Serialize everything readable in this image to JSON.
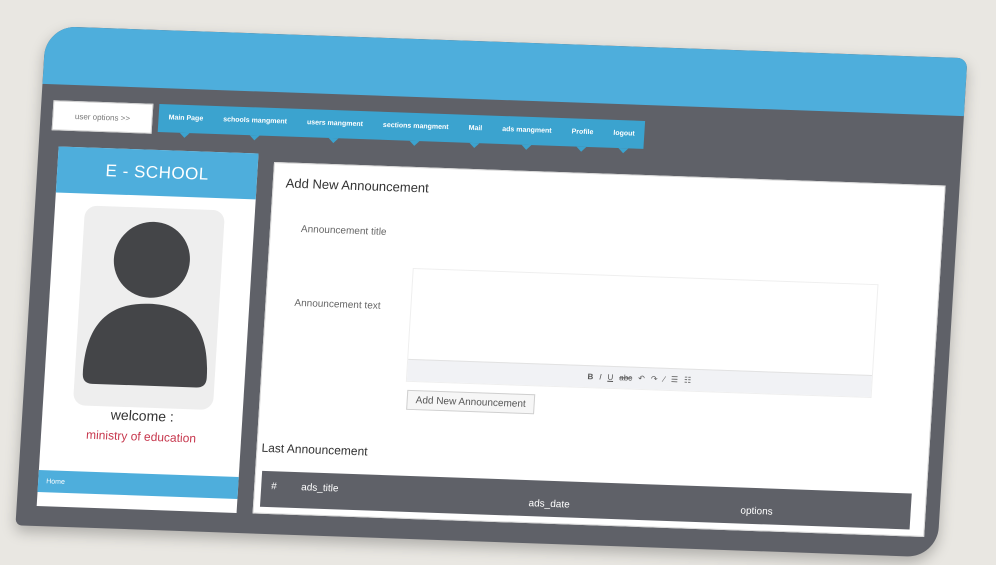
{
  "top": {
    "user_options_label": "user options >>"
  },
  "nav": {
    "items": [
      {
        "label": "Main Page"
      },
      {
        "label": "schools mangment"
      },
      {
        "label": "users mangment"
      },
      {
        "label": "sections mangment"
      },
      {
        "label": "Mail"
      },
      {
        "label": "ads mangment"
      },
      {
        "label": "Profile"
      },
      {
        "label": "logout"
      }
    ]
  },
  "sidebar": {
    "brand": "E - SCHOOL",
    "avatar_icon": "user-silhouette-icon",
    "welcome": "welcome :",
    "user_name": "ministry of education",
    "home_link": "Home"
  },
  "form": {
    "title": "Add New Announcement",
    "title_label": "Announcement title",
    "text_label": "Announcement text",
    "toolbar": [
      "B",
      "I",
      "U",
      "abc",
      "↶",
      "↷",
      "⁄",
      "☰",
      "☷"
    ],
    "submit_label": "Add New Announcement"
  },
  "list": {
    "title": "Last Announcement",
    "columns": [
      "#",
      "ads_title",
      "ads_date",
      "options"
    ]
  },
  "colors": {
    "accent_blue": "#4eaedc",
    "frame_gray": "#5f6168",
    "name_red": "#c7384e"
  }
}
